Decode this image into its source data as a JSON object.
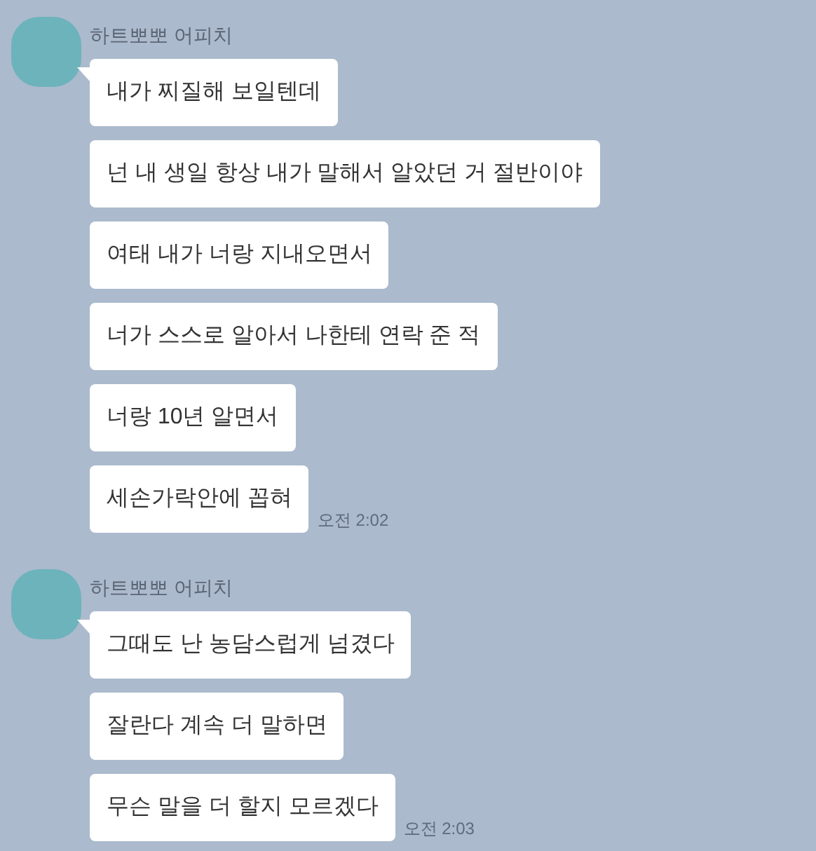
{
  "groups": [
    {
      "sender": "하트뽀뽀 어피치",
      "time": "오전 2:02",
      "messages": [
        "내가 찌질해 보일텐데",
        "넌 내 생일 항상 내가 말해서 알았던 거 절반이야",
        "여태 내가 너랑 지내오면서",
        "너가 스스로 알아서 나한테 연락 준 적",
        "너랑 10년 알면서",
        "세손가락안에 꼽혀"
      ]
    },
    {
      "sender": "하트뽀뽀 어피치",
      "time": "오전 2:03",
      "messages": [
        "그때도 난 농담스럽게 넘겼다",
        "잘란다 계속 더 말하면",
        "무슨 말을 더 할지 모르겠다"
      ]
    }
  ]
}
